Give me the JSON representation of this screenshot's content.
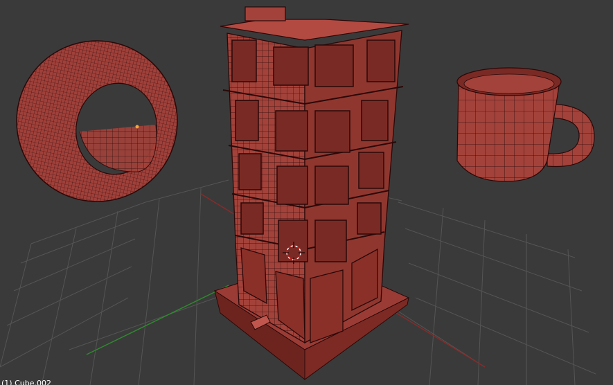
{
  "viewport": {
    "object_label": "(1) Cube.002",
    "background": "#3a3a3a",
    "grid_color": "#555555",
    "axis_x_color": "#8a2a2a",
    "axis_y_color": "#2e8b2e",
    "mesh_fill": "#a3423a",
    "mesh_dark": "#6a1f1a",
    "wire_color": "#2a0808",
    "cursor_color": "#ffffff",
    "origin_color": "#f2a93b"
  },
  "objects": [
    {
      "name": "tire",
      "icon": "torus-mesh"
    },
    {
      "name": "building",
      "icon": "building-mesh"
    },
    {
      "name": "mug",
      "icon": "mug-mesh"
    }
  ]
}
